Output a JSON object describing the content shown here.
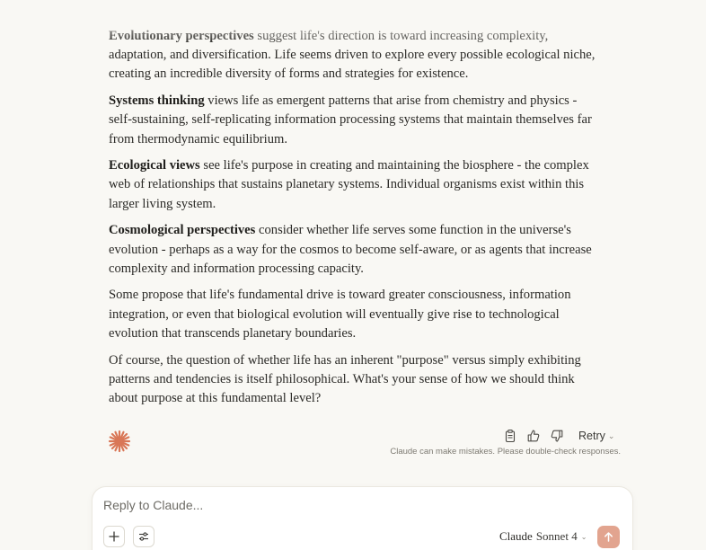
{
  "message": {
    "paragraphs": [
      {
        "bold": "Evolutionary perspectives",
        "text": " suggest life's direction is toward increasing complexity, adaptation, and diversification. Life seems driven to explore every possible ecological niche, creating an incredible diversity of forms and strategies for existence."
      },
      {
        "bold": "Systems thinking",
        "text": " views life as emergent patterns that arise from chemistry and physics - self-sustaining, self-replicating information processing systems that maintain themselves far from thermodynamic equilibrium."
      },
      {
        "bold": "Ecological views",
        "text": " see life's purpose in creating and maintaining the biosphere - the complex web of relationships that sustains planetary systems. Individual organisms exist within this larger living system."
      },
      {
        "bold": "Cosmological perspectives",
        "text": " consider whether life serves some function in the universe's evolution - perhaps as a way for the cosmos to become self-aware, or as agents that increase complexity and information processing capacity."
      },
      {
        "bold": "",
        "text": "Some propose that life's fundamental drive is toward greater consciousness, information integration, or even that biological evolution will eventually give rise to technological evolution that transcends planetary boundaries."
      },
      {
        "bold": "",
        "text": "Of course, the question of whether life has an inherent \"purpose\" versus simply exhibiting patterns and tendencies is itself philosophical. What's your sense of how we should think about purpose at this fundamental level?"
      }
    ]
  },
  "actions": {
    "copy_icon": "clipboard-icon",
    "thumbs_up_icon": "thumbs-up-icon",
    "thumbs_down_icon": "thumbs-down-icon",
    "retry_label": "Retry"
  },
  "disclaimer": "Claude can make mistakes. Please double-check responses.",
  "composer": {
    "placeholder": "Reply to Claude...",
    "model_name": "Claude",
    "model_version": "Sonnet 4"
  },
  "colors": {
    "accent": "#d97757",
    "send_button": "#e2a48f",
    "background": "#f9f8f4"
  }
}
